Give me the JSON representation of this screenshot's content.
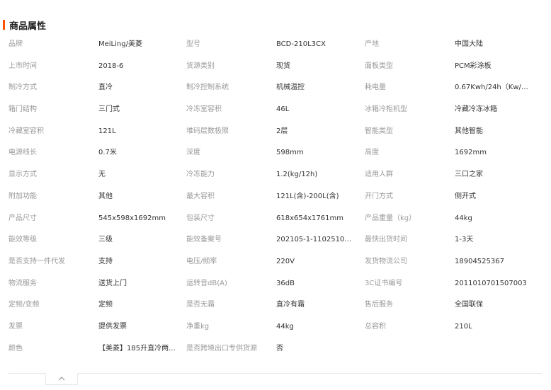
{
  "section": {
    "title": "商品属性"
  },
  "rows": [
    [
      {
        "label": "品牌",
        "value": "MeiLing/美菱"
      },
      {
        "label": "型号",
        "value": "BCD-210L3CX"
      },
      {
        "label": "产地",
        "value": "中国大陆"
      }
    ],
    [
      {
        "label": "上市时间",
        "value": "2018-6"
      },
      {
        "label": "货源类别",
        "value": "现货"
      },
      {
        "label": "面板类型",
        "value": "PCM彩涂板"
      }
    ],
    [
      {
        "label": "制冷方式",
        "value": "直冷"
      },
      {
        "label": "制冷控制系统",
        "value": "机械温控"
      },
      {
        "label": "耗电量",
        "value": "0.67Kwh/24h（Kw/天..."
      }
    ],
    [
      {
        "label": "箱门结构",
        "value": "三门式"
      },
      {
        "label": "冷冻室容积",
        "value": "46L"
      },
      {
        "label": "冰箱冷柜机型",
        "value": "冷藏冷冻冰箱"
      }
    ],
    [
      {
        "label": "冷藏室容积",
        "value": "121L"
      },
      {
        "label": "堆码层数极限",
        "value": "2层"
      },
      {
        "label": "智能类型",
        "value": "其他智能"
      }
    ],
    [
      {
        "label": "电源线长",
        "value": "0.7米"
      },
      {
        "label": "深度",
        "value": "598mm"
      },
      {
        "label": "高度",
        "value": "1692mm"
      }
    ],
    [
      {
        "label": "显示方式",
        "value": "无"
      },
      {
        "label": "冷冻能力",
        "value": "1.2(kg/12h)"
      },
      {
        "label": "适用人群",
        "value": "三口之家"
      }
    ],
    [
      {
        "label": "附加功能",
        "value": "其他"
      },
      {
        "label": "最大容积",
        "value": "121L(含)-200L(含)"
      },
      {
        "label": "开门方式",
        "value": "侧开式"
      }
    ],
    [
      {
        "label": "产品尺寸",
        "value": "545x598x1692mm"
      },
      {
        "label": "包装尺寸",
        "value": "618x654x1761mm"
      },
      {
        "label": "产品重量（kg）",
        "value": "44kg"
      }
    ],
    [
      {
        "label": "能效等级",
        "value": "三级"
      },
      {
        "label": "能效备案号",
        "value": "202105-1-11025108-..."
      },
      {
        "label": "最快出货时间",
        "value": "1-3天"
      }
    ],
    [
      {
        "label": "是否支持一件代发",
        "value": "支持"
      },
      {
        "label": "电压/频率",
        "value": "220V"
      },
      {
        "label": "发货物流公司",
        "value": "18904525367"
      }
    ],
    [
      {
        "label": "物流服务",
        "value": "送货上门"
      },
      {
        "label": "运转音dB(A)",
        "value": "36dB"
      },
      {
        "label": "3C证书编号",
        "value": "2011010701507003"
      }
    ],
    [
      {
        "label": "定频/变频",
        "value": "定频"
      },
      {
        "label": "是否无霜",
        "value": "直冷有霜"
      },
      {
        "label": "售后服务",
        "value": "全国联保"
      }
    ],
    [
      {
        "label": "发票",
        "value": "提供发票"
      },
      {
        "label": "净重kg",
        "value": "44kg"
      },
      {
        "label": "总容积",
        "value": "210L"
      }
    ],
    [
      {
        "label": "颜色",
        "value": "【美菱】185升直冷两..."
      },
      {
        "label": "是否跨境出口专供货源",
        "value": "否"
      }
    ]
  ],
  "icons": {
    "collapse": "chevron-up-icon"
  },
  "colors": {
    "accent": "#ff5000",
    "label": "#999999",
    "value": "#333333"
  }
}
